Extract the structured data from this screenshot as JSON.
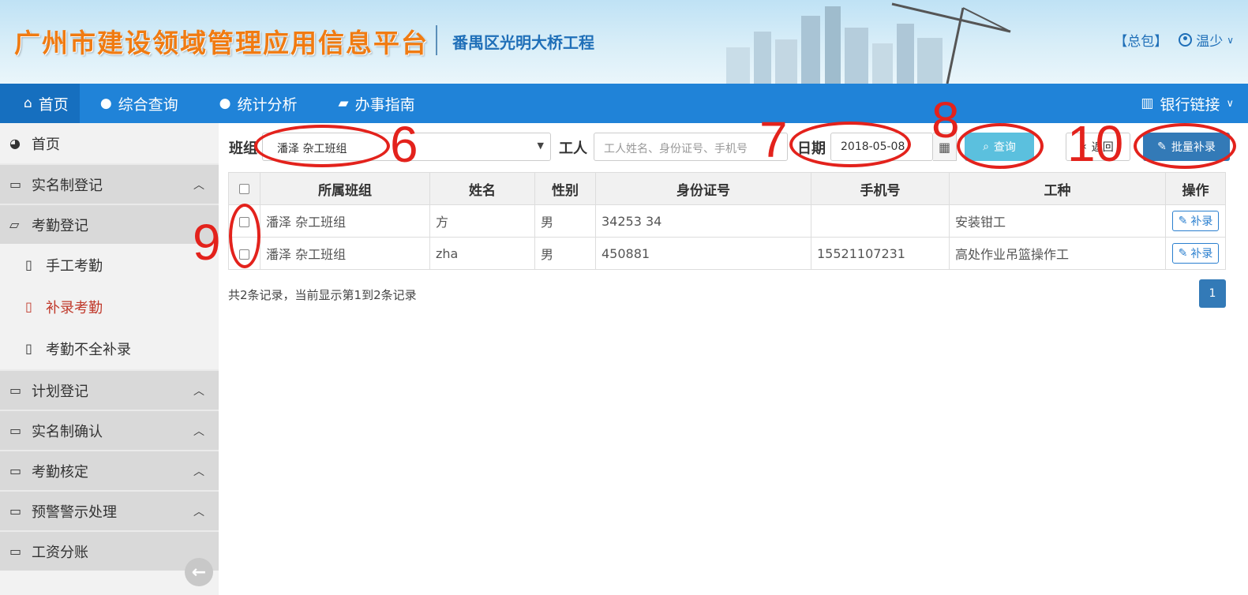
{
  "header": {
    "platform_title": "广州市建设领域管理应用信息平台",
    "project_name": "番禺区光明大桥工程",
    "contractor_link": "【总包】",
    "user_name": "温少",
    "user_caret": "∨"
  },
  "navbar": {
    "items": [
      {
        "label": "首页",
        "icon": "home-icon"
      },
      {
        "label": "综合查询",
        "icon": "globe-icon"
      },
      {
        "label": "统计分析",
        "icon": "globe-icon"
      },
      {
        "label": "办事指南",
        "icon": "book-icon"
      }
    ],
    "bank_link": "银行链接"
  },
  "sidebar": {
    "home": "首页",
    "groups": [
      {
        "label": "实名制登记"
      },
      {
        "label": "考勤登记"
      },
      {
        "label": "计划登记"
      },
      {
        "label": "实名制确认"
      },
      {
        "label": "考勤核定"
      },
      {
        "label": "预警警示处理"
      },
      {
        "label": "工资分账"
      }
    ],
    "attendance_sub": [
      {
        "label": "手工考勤"
      },
      {
        "label": "补录考勤"
      },
      {
        "label": "考勤不全补录"
      }
    ]
  },
  "filter": {
    "team_label": "班组",
    "team_value": "潘泽  杂工班组",
    "worker_label": "工人",
    "worker_placeholder": "工人姓名、身份证号、手机号",
    "date_label": "日期",
    "date_value": "2018-05-08",
    "query_button": "查询",
    "back_button": "返回",
    "batch_button": "批量补录"
  },
  "table": {
    "headers": [
      "所属班组",
      "姓名",
      "性别",
      "身份证号",
      "手机号",
      "工种",
      "操作"
    ],
    "rows": [
      {
        "team": "潘泽  杂工班组",
        "name": "方",
        "gender": "男",
        "id_no": "34253        34",
        "phone": "",
        "job": "安装钳工",
        "action": "补录"
      },
      {
        "team": "潘泽  杂工班组",
        "name": "zha",
        "gender": "男",
        "id_no": "450881",
        "phone": "15521107231",
        "job": "高处作业吊篮操作工",
        "action": "补录"
      }
    ],
    "summary": "共2条记录，当前显示第1到2条记录",
    "page": "1"
  },
  "annotations": [
    "6",
    "7",
    "8",
    "9",
    "10"
  ],
  "colors": {
    "nav_blue": "#2083d8",
    "accent_blue": "#337ab7",
    "query_cyan": "#5bc0de",
    "annotation_red": "#e3221c",
    "active_menu_red": "#c0392b"
  }
}
